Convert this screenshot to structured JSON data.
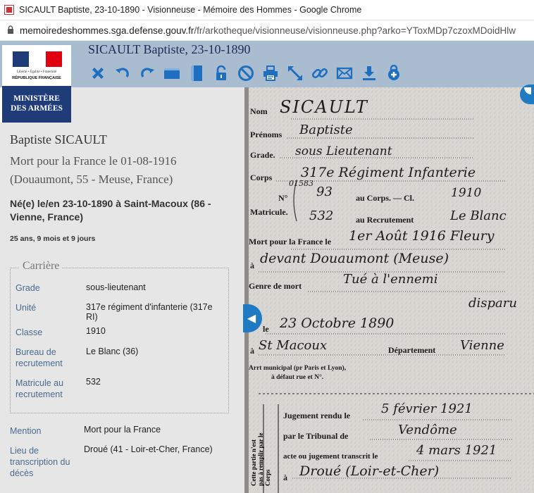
{
  "browser": {
    "window_title": "SICAULT Baptiste, 23-10-1890 - Visionneuse - Mémoire des Hommes - Google Chrome",
    "url_host": "memoiredeshommes.sga.defense.gouv.fr",
    "url_path": "/fr/arkotheque/visionneuse/visionneuse.php?arko=YToxMDp7czoxMDoidHlw"
  },
  "logo": {
    "motto": "Liberté • Égalité • Fraternité",
    "republic": "RÉPUBLIQUE FRANÇAISE",
    "ministry_line1": "MINISTÈRE",
    "ministry_line2": "DES ARMÉES"
  },
  "header": {
    "title": "SICAULT Baptiste, 23-10-1890"
  },
  "toolbar": [
    {
      "name": "close-icon",
      "color": "#1f6fc0"
    },
    {
      "name": "rotate-left-icon",
      "color": "#1f6fc0"
    },
    {
      "name": "rotate-right-icon",
      "color": "#1f6fc0"
    },
    {
      "name": "fit-width-icon",
      "color": "#1f6fc0"
    },
    {
      "name": "fit-height-icon",
      "color": "#1f6fc0"
    },
    {
      "name": "lock-icon",
      "color": "#1f6fc0"
    },
    {
      "name": "no-entry-icon",
      "color": "#1f6fc0"
    },
    {
      "name": "print-icon",
      "color": "#1f6fc0"
    },
    {
      "name": "fullscreen-icon",
      "color": "#1f6fc0"
    },
    {
      "name": "link-icon",
      "color": "#1f6fc0"
    },
    {
      "name": "mail-icon",
      "color": "#1f6fc0"
    },
    {
      "name": "download-icon",
      "color": "#1f6fc0"
    },
    {
      "name": "cart-icon",
      "color": "#1f6fc0"
    }
  ],
  "person": {
    "name": "Baptiste SICAULT",
    "death": "Mort pour la France le 01-08-1916 (Douaumont, 55 - Meuse, France)",
    "birth": "Né(e) le/en 23-10-1890 à Saint-Macoux (86 - Vienne, France)",
    "age": "25 ans, 9 mois et 9 jours"
  },
  "carriere": {
    "legend": "Carrière",
    "fields": [
      {
        "label": "Grade",
        "value": "sous-lieutenant"
      },
      {
        "label": "Unité",
        "value": "317e régiment d'infanterie (317e RI)"
      },
      {
        "label": "Classe",
        "value": "1910"
      },
      {
        "label": "Bureau de recrutement",
        "value": "Le Blanc (36)"
      },
      {
        "label": "Matricule au recrutement",
        "value": "532"
      }
    ]
  },
  "mentions": [
    {
      "label": "Mention",
      "value": "Mort pour la France"
    },
    {
      "label": "Lieu de transcription du décès",
      "value": "Droué (41 - Loir-et-Cher, France)"
    }
  ],
  "document": {
    "nom_label": "Nom",
    "nom_value": "SICAULT",
    "prenoms_label": "Prénoms",
    "prenoms_value": "Baptiste",
    "grade_label": "Grade.",
    "grade_value": "sous Lieutenant",
    "corps_label": "Corps",
    "corps_value": "317e Régiment Infanterie",
    "no_label": "N°",
    "matricule_label": "Matricule.",
    "no_value_small": "01583",
    "au_corps_value": "93",
    "au_corps_label": "au Corps. — Cl.",
    "classe_value": "1910",
    "recrutement_value": "532",
    "recrutement_label": "au Recrutement",
    "bureau_value": "Le Blanc",
    "mort_label": "Mort pour la France le",
    "mort_value": "1er Août 1916 Fleury",
    "a_label": "à",
    "lieu_value": "devant Douaumont (Meuse)",
    "genre_label": "Genre de mort",
    "genre_value": "Tué à l'ennemi",
    "genre_value2": "disparu",
    "ne_label": "le",
    "ne_value": "23 Octobre 1890",
    "a2_label": "à",
    "ne_lieu_value": "St Macoux",
    "dept_label": "Département",
    "dept_value": "Vienne",
    "arr_label1": "Arrt municipal (pr Paris et Lyon),",
    "arr_label2": "à défaut rue et N°.",
    "jug_label": "Jugement rendu le",
    "jug_value": "5 février 1921",
    "trib_label": "par le Tribunal de",
    "trib_value": "Vendôme",
    "acte_label": "acte ou jugement transcrit le",
    "acte_value": "4 mars 1921",
    "a3_label": "à",
    "transcrit_value": "Droué (Loir-et-Cher)",
    "vertical_note": "Cette partie n'est pas à remplir par le Corps"
  }
}
